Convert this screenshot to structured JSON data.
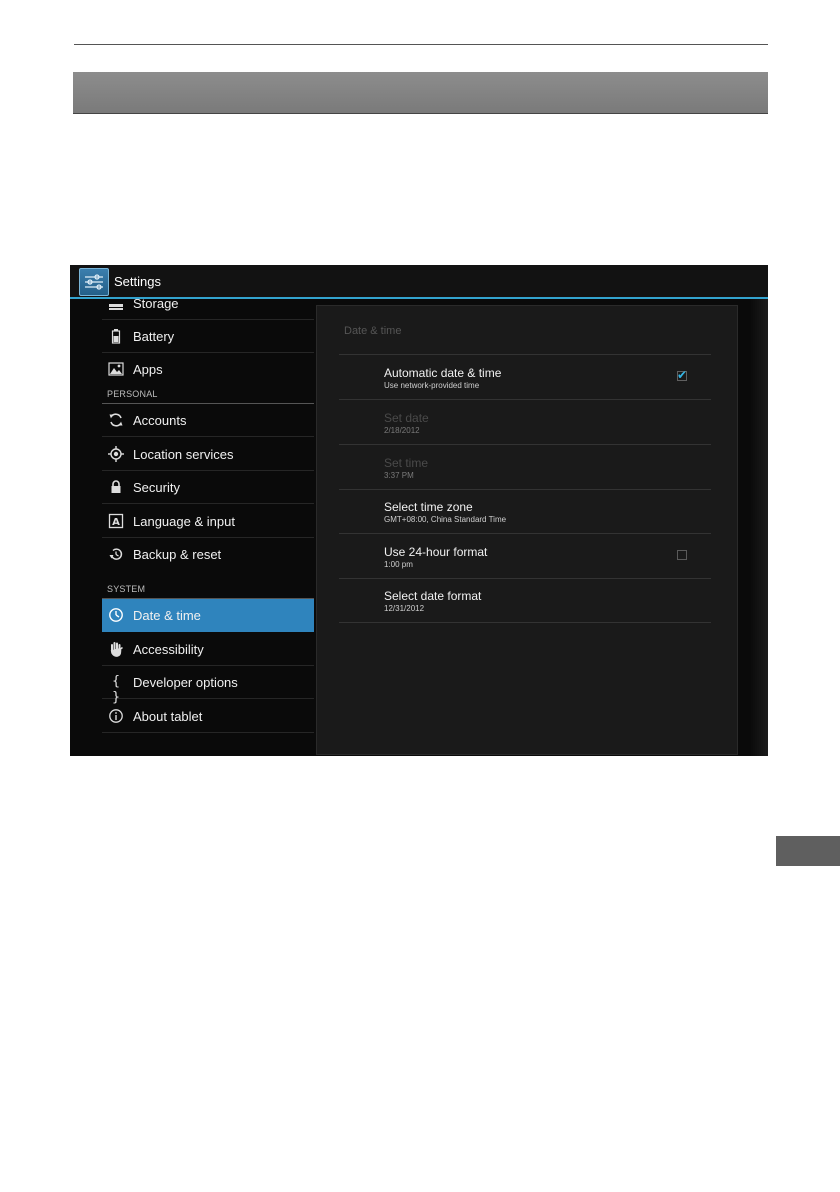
{
  "action_bar": {
    "title": "Settings",
    "icon": "settings-sliders-icon"
  },
  "sidebar": {
    "items": [
      {
        "label": "Storage",
        "icon": "storage-icon"
      },
      {
        "label": "Battery",
        "icon": "battery-icon"
      },
      {
        "label": "Apps",
        "icon": "apps-icon"
      },
      {
        "label": "Accounts",
        "icon": "sync-icon"
      },
      {
        "label": "Location services",
        "icon": "location-icon"
      },
      {
        "label": "Security",
        "icon": "lock-icon"
      },
      {
        "label": "Language & input",
        "icon": "keyboard-a-icon"
      },
      {
        "label": "Backup & reset",
        "icon": "restore-icon"
      },
      {
        "label": "Date & time",
        "icon": "clock-icon",
        "selected": true
      },
      {
        "label": "Accessibility",
        "icon": "hand-icon"
      },
      {
        "label": "Developer options",
        "icon": "braces-icon"
      },
      {
        "label": "About tablet",
        "icon": "info-icon"
      }
    ],
    "sections": {
      "personal": "PERSONAL",
      "system": "SYSTEM"
    }
  },
  "detail": {
    "heading": "Date & time",
    "rows": [
      {
        "title": "Automatic date & time",
        "summary": "Use network-provided time",
        "checked": true
      },
      {
        "title": "Set date",
        "summary": "2/18/2012",
        "disabled": true
      },
      {
        "title": "Set time",
        "summary": "3:37 PM",
        "disabled": true
      },
      {
        "title": "Select time zone",
        "summary": "GMT+08:00, China Standard Time"
      },
      {
        "title": "Use 24-hour format",
        "summary": "1:00 pm",
        "checked": false
      },
      {
        "title": "Select date format",
        "summary": "12/31/2012"
      }
    ]
  },
  "colors": {
    "accent": "#33a3cf",
    "selected_bg": "#2f84bd",
    "check": "#33b5e5"
  }
}
